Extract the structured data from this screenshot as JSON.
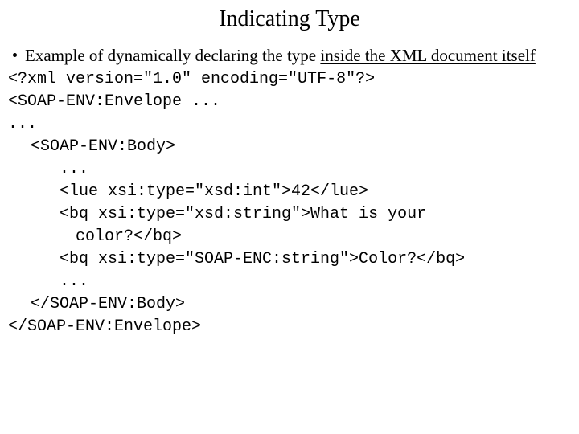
{
  "title": "Indicating Type",
  "bullet": {
    "prefix": "Example of dynamically declaring the type ",
    "underlined": "inside the XML document itself"
  },
  "code": {
    "l1": "<?xml version=\"1.0\" encoding=\"UTF-8\"?>",
    "l2": "<SOAP-ENV:Envelope ...",
    "l3": "...",
    "l4": "<SOAP-ENV:Body>",
    "l5": "...",
    "l6": "<lue xsi:type=\"xsd:int\">42</lue>",
    "l7a": "<bq xsi:type=\"xsd:string\">What is your",
    "l7b": "color?</bq>",
    "l8": "<bq xsi:type=\"SOAP-ENC:string\">Color?</bq>",
    "l9": "...",
    "l10": "</SOAP-ENV:Body>",
    "l11": "</SOAP-ENV:Envelope>"
  }
}
